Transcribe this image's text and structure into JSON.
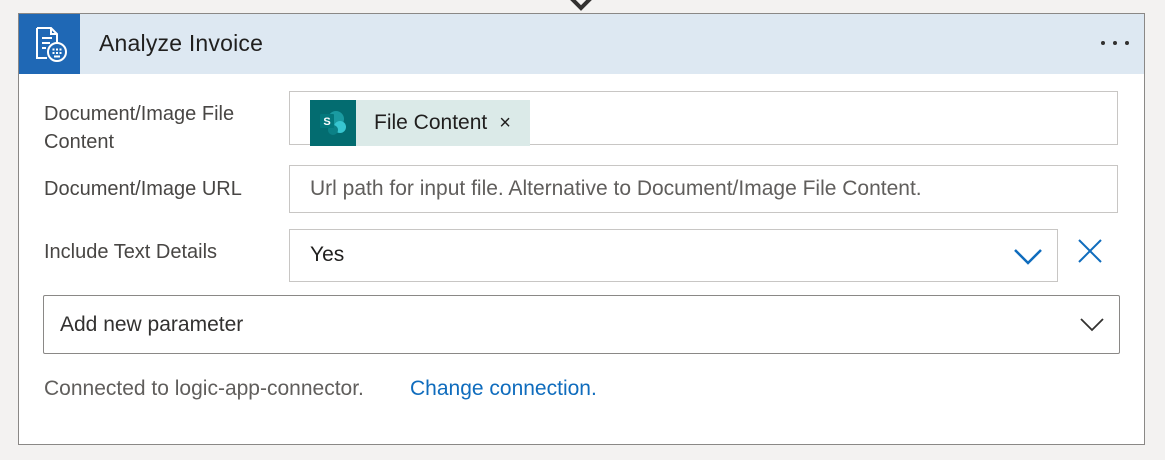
{
  "card": {
    "title": "Analyze Invoice",
    "icon": "invoice-document-icon",
    "more_icon": "ellipsis-icon"
  },
  "fields": {
    "file_content": {
      "label_line1": "Document/Image File",
      "label_line2": "Content",
      "token_label": "File Content",
      "token_icon": "sharepoint-icon",
      "token_logo_letter": "S",
      "token_remove": "×"
    },
    "url": {
      "label": "Document/Image URL",
      "placeholder": "Url path for input file. Alternative to Document/Image File Content.",
      "value": ""
    },
    "text_details": {
      "label": "Include Text Details",
      "value": "Yes",
      "chevron_icon": "chevron-down-icon",
      "clear_icon": "close-icon"
    }
  },
  "add_parameter": {
    "label": "Add new parameter",
    "chevron_icon": "chevron-down-icon"
  },
  "connection": {
    "text": "Connected to logic-app-connector.",
    "link_label": "Change connection."
  },
  "colors": {
    "header_bg": "#dde8f2",
    "icon_bg": "#1f68b5",
    "token_bg": "#dbeae8",
    "token_logo_bg": "#036c70",
    "accent": "#0f6cbd"
  }
}
